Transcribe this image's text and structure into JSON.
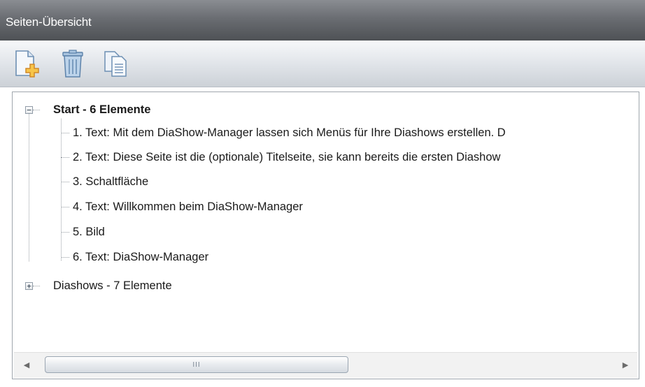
{
  "window": {
    "title": "Seiten-Übersicht"
  },
  "toolbar": {
    "buttons": [
      {
        "icon": "add-page-icon"
      },
      {
        "icon": "trash-icon"
      },
      {
        "icon": "copy-page-icon"
      }
    ]
  },
  "tree": {
    "nodes": [
      {
        "label": "Start - 6 Elemente",
        "expanded": true,
        "toggle": "−",
        "children": [
          "1. Text: Mit dem DiaShow-Manager lassen sich Menüs für Ihre Diashows erstellen. D",
          "2. Text: Diese Seite ist die (optionale) Titelseite, sie kann bereits die ersten Diashow",
          "3. Schaltfläche",
          "4. Text: Willkommen beim DiaShow-Manager",
          "5. Bild",
          "6. Text: DiaShow-Manager"
        ]
      },
      {
        "label": "Diashows - 7 Elemente",
        "expanded": false,
        "toggle": "+"
      }
    ]
  },
  "scrollbar": {
    "left_arrow": "◀",
    "right_arrow": "▶",
    "grip": "III"
  }
}
